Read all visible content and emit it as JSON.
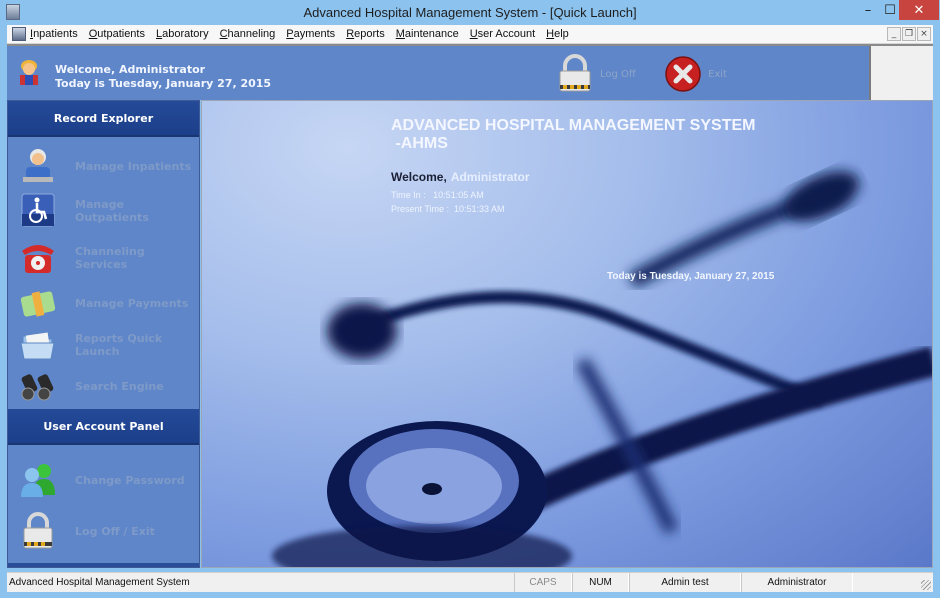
{
  "window": {
    "title": "Advanced Hospital Management System - [Quick Launch]",
    "controls": {
      "minimize": "–",
      "maximize": "☐",
      "close": "✕"
    }
  },
  "menu": {
    "items": [
      "Inpatients",
      "Outpatients",
      "Laboratory",
      "Channeling",
      "Payments",
      "Reports",
      "Maintenance",
      "User Account",
      "Help"
    ],
    "mdi_controls": {
      "minimize": "_",
      "restore": "❐",
      "close": "×"
    }
  },
  "header": {
    "welcome": "Welcome, Administrator",
    "date": "Today is Tuesday, January 27, 2015",
    "logoff_label": "Log Off",
    "exit_label": "Exit"
  },
  "sidebar": {
    "record_explorer": {
      "title": "Record Explorer",
      "items": [
        {
          "label": "Manage Inpatients",
          "icon": "nurse-icon"
        },
        {
          "label": "Manage Outpatients",
          "icon": "wheelchair-icon"
        },
        {
          "label": "Channeling Services",
          "icon": "telephone-icon"
        },
        {
          "label": "Manage Payments",
          "icon": "money-icon"
        },
        {
          "label": "Reports Quick Launch",
          "icon": "folder-icon"
        },
        {
          "label": "Search Engine",
          "icon": "binoculars-icon"
        }
      ]
    },
    "user_account": {
      "title": "User Account Panel",
      "items": [
        {
          "label": "Change Password",
          "icon": "users-icon"
        },
        {
          "label": "Log Off / Exit",
          "icon": "padlock-icon"
        }
      ]
    }
  },
  "main": {
    "title_line1": "ADVANCED HOSPITAL MANAGEMENT SYSTEM",
    "title_line2": " -AHMS",
    "welcome_label": "Welcome,",
    "welcome_user": "Administrator",
    "time_in": "Time In :   10:51:05 AM",
    "present_time": "Present Time :  10:51:33 AM",
    "date": "Today is Tuesday, January 27, 2015"
  },
  "statusbar": {
    "text": "Advanced Hospital Management System",
    "caps": "CAPS",
    "num": "NUM",
    "user": "Admin test",
    "role": "Administrator"
  },
  "colors": {
    "titlebar": "#8cc2ee",
    "panel_blue": "#5f86c9",
    "header_navy": "#1c3f8a",
    "close_red": "#c7453e"
  }
}
